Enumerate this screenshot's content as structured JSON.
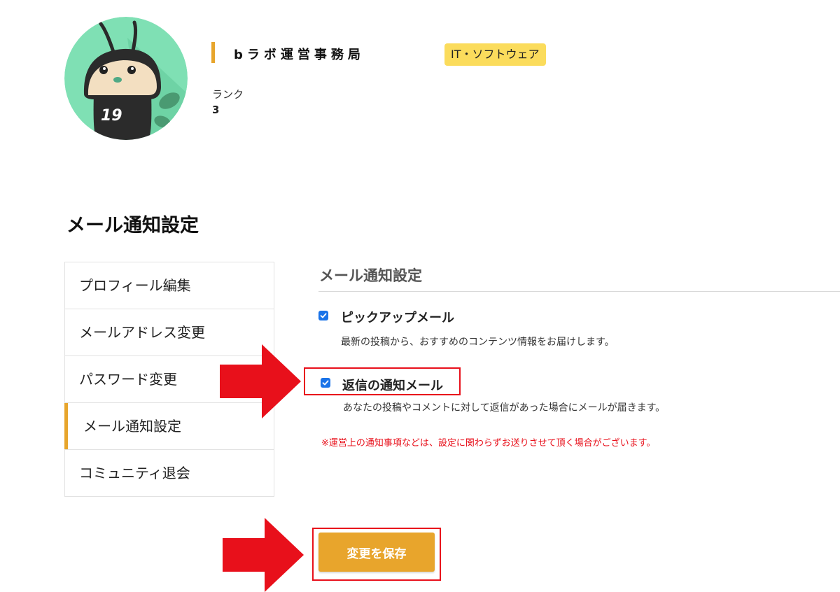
{
  "profile": {
    "name": "bラボ運営事務局",
    "category": "IT・ソフトウェア",
    "rank_label": "ランク",
    "rank_value": "3",
    "avatar_jersey_number": "19"
  },
  "page_title": "メール通知設定",
  "sidebar": {
    "items": [
      {
        "label": "プロフィール編集",
        "active": false
      },
      {
        "label": "メールアドレス変更",
        "active": false
      },
      {
        "label": "パスワード変更",
        "active": false
      },
      {
        "label": "メール通知設定",
        "active": true
      },
      {
        "label": "コミュニティ退会",
        "active": false
      }
    ]
  },
  "settings": {
    "heading": "メール通知設定",
    "options": [
      {
        "label": "ピックアップメール",
        "description": "最新の投稿から、おすすめのコンテンツ情報をお届けします。",
        "checked": true
      },
      {
        "label": "返信の通知メール",
        "description": "あなたの投稿やコメントに対して返信があった場合にメールが届きます。",
        "checked": true
      }
    ],
    "note": "※運営上の通知事項などは、設定に関わらずお送りさせて頂く場合がございます。",
    "save_label": "変更を保存"
  },
  "colors": {
    "accent": "#e7a52c",
    "badge": "#fbdc5c",
    "checkbox": "#1a73e8",
    "annotation_red": "#e8101b",
    "note_red": "#e8101b"
  },
  "icons": {
    "checkbox": "checkmark-icon",
    "annotation": "arrow-right-icon"
  }
}
